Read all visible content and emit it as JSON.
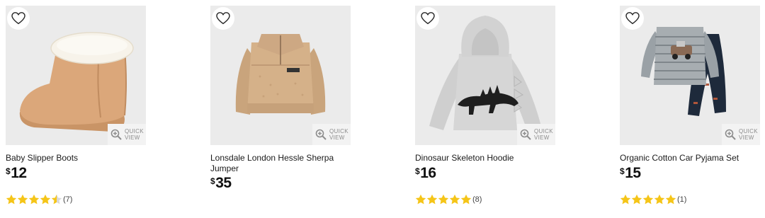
{
  "colors": {
    "star": "#f5c518",
    "star_empty": "#d9d9d9",
    "image_bg": "#ebebeb"
  },
  "icons": {
    "favourite": "heart-outline-icon",
    "quick_view": "magnifier-plus-icon",
    "rating": "star-icon"
  },
  "products": [
    {
      "name": "Baby Slipper Boots",
      "price_symbol": "$",
      "price": "12",
      "rating": 4.5,
      "review_count": "(7)",
      "quick_view_label": "QUICK VIEW"
    },
    {
      "name": "Lonsdale London Hessle Sherpa Jumper",
      "price_symbol": "$",
      "price": "35",
      "rating": null,
      "review_count": "",
      "quick_view_label": "QUICK VIEW"
    },
    {
      "name": "Dinosaur Skeleton Hoodie",
      "price_symbol": "$",
      "price": "16",
      "rating": 5,
      "review_count": "(8)",
      "quick_view_label": "QUICK VIEW"
    },
    {
      "name": "Organic Cotton Car Pyjama Set",
      "price_symbol": "$",
      "price": "15",
      "rating": 5,
      "review_count": "(1)",
      "quick_view_label": "QUICK VIEW"
    }
  ]
}
